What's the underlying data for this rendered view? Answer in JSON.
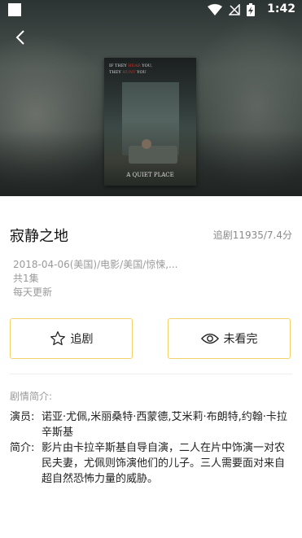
{
  "status_bar": {
    "time": "1:42"
  },
  "poster": {
    "tagline_1": "IF THEY",
    "tagline_2": "HEAR",
    "tagline_3": "YOU,",
    "tagline_4": "THEY",
    "tagline_5": "HUNT",
    "tagline_6": "YOU",
    "title": "A QUIET PLACE"
  },
  "movie": {
    "title": "寂静之地",
    "meta": "追剧11935/7.4分",
    "info_line": "2018-04-06(美国)/电影/美国/惊悚,...",
    "episodes": "共1集",
    "update": "每天更新"
  },
  "actions": {
    "follow_label": "追剧",
    "unwatched_label": "未看完"
  },
  "synopsis": {
    "section_label": "剧情简介:",
    "cast_key": "演员:",
    "cast_value": "诺亚·尤佩,米丽桑特·西蒙德,艾米莉·布朗特,约翰·卡拉辛斯基",
    "summary_key": "简介:",
    "summary_value": "影片由卡拉辛斯基自导自演，二人在片中饰演一对农民夫妻，尤佩则饰演他们的儿子。三人需要面对来自超自然恐怖力量的威胁。"
  },
  "icons": {
    "back": "arrow-left-icon",
    "follow": "star-icon",
    "unwatched": "eye-icon",
    "wifi": "wifi-icon",
    "signal": "no-signal-icon",
    "battery": "battery-charging-icon"
  },
  "colors": {
    "button_border": "#f2d36a",
    "muted_text": "#9a9a9a"
  }
}
